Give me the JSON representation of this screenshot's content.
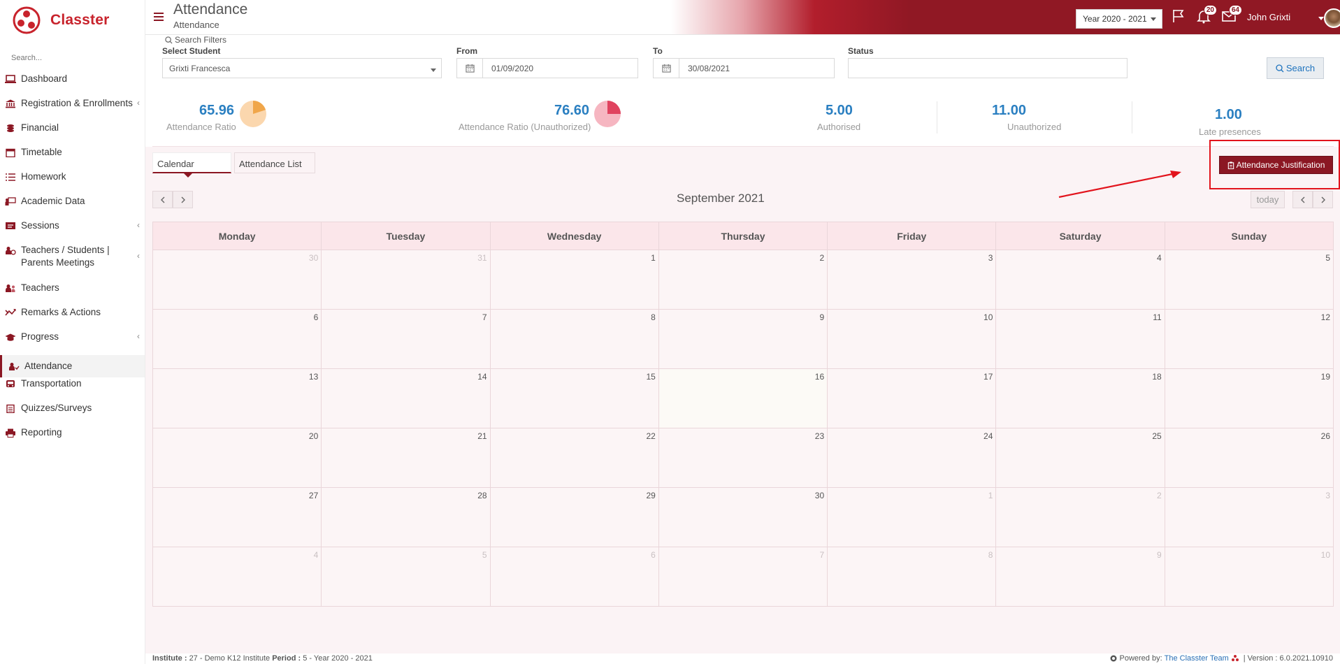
{
  "app": {
    "name": "Classter",
    "brand_color": "#c8232c",
    "accent_color": "#8b1723"
  },
  "sidebar": {
    "search_placeholder": "Search...",
    "items": [
      {
        "label": "Dashboard",
        "icon": "laptop-icon",
        "chevron": false
      },
      {
        "label": "Registration & Enrollments",
        "icon": "bank-icon",
        "chevron": true
      },
      {
        "label": "Financial",
        "icon": "coins-icon",
        "chevron": false
      },
      {
        "label": "Timetable",
        "icon": "calendar-icon",
        "chevron": false
      },
      {
        "label": "Homework",
        "icon": "list-icon",
        "chevron": false
      },
      {
        "label": "Academic Data",
        "icon": "presentation-icon",
        "chevron": false
      },
      {
        "label": "Sessions",
        "icon": "sessions-icon",
        "chevron": true
      },
      {
        "label": "Teachers / Students | Parents Meetings",
        "icon": "users-meeting-icon",
        "chevron": true
      },
      {
        "label": "Teachers",
        "icon": "teachers-icon",
        "chevron": false
      },
      {
        "label": "Remarks & Actions",
        "icon": "shuffle-icon",
        "chevron": false
      },
      {
        "label": "Progress",
        "icon": "graduation-cap-icon",
        "chevron": true
      },
      {
        "label": "Attendance",
        "icon": "user-check-icon",
        "chevron": false,
        "active": true
      },
      {
        "label": "Transportation",
        "icon": "bus-icon",
        "chevron": false
      },
      {
        "label": "Quizzes/Surveys",
        "icon": "clipboard-icon",
        "chevron": false
      },
      {
        "label": "Reporting",
        "icon": "printer-icon",
        "chevron": false
      }
    ]
  },
  "header": {
    "title": "Attendance",
    "subtitle": "Attendance",
    "year": "Year 2020 - 2021",
    "notifications_count": "20",
    "messages_count": "64",
    "user_name": "John Grixti"
  },
  "filters": {
    "legend": "Search Filters",
    "student_label": "Select Student",
    "student_value": "Grixti Francesca",
    "from_label": "From",
    "from_value": "01/09/2020",
    "to_label": "To",
    "to_value": "30/08/2021",
    "status_label": "Status",
    "status_value": "",
    "search_label": "Search"
  },
  "stats": {
    "attendance_ratio": {
      "value": "65.96",
      "label": "Attendance Ratio",
      "fraction": 0.2,
      "color": "#f0a64a"
    },
    "attendance_ratio_unauth": {
      "value": "76.60",
      "label": "Attendance Ratio (Unauthorized)",
      "fraction": 0.25,
      "color": "#e0435f"
    },
    "authorised": {
      "value": "5.00",
      "label": "Authorised"
    },
    "unauthorized": {
      "value": "11.00",
      "label": "Unauthorized"
    },
    "late": {
      "value": "1.00",
      "label": "Late presences"
    }
  },
  "tabs": {
    "calendar": "Calendar",
    "list": "Attendance List"
  },
  "justification_button": "Attendance Justification",
  "calendar": {
    "title": "September 2021",
    "today_label": "today",
    "days": [
      "Monday",
      "Tuesday",
      "Wednesday",
      "Thursday",
      "Friday",
      "Saturday",
      "Sunday"
    ],
    "weeks": [
      [
        "30",
        "31",
        "1",
        "2",
        "3",
        "4",
        "5"
      ],
      [
        "6",
        "7",
        "8",
        "9",
        "10",
        "11",
        "12"
      ],
      [
        "13",
        "14",
        "15",
        "16",
        "17",
        "18",
        "19"
      ],
      [
        "20",
        "21",
        "22",
        "23",
        "24",
        "25",
        "26"
      ],
      [
        "27",
        "28",
        "29",
        "30",
        "1",
        "2",
        "3"
      ],
      [
        "4",
        "5",
        "6",
        "7",
        "8",
        "9",
        "10"
      ]
    ]
  },
  "footer": {
    "institute_label": "Institute :",
    "institute_value": "27 - Demo K12 Institute",
    "period_label": "Period :",
    "period_value": "5 - Year 2020 - 2021",
    "powered_by": "Powered by:",
    "team": "The Classter Team",
    "version": "| Version : 6.0.2021.10910"
  }
}
